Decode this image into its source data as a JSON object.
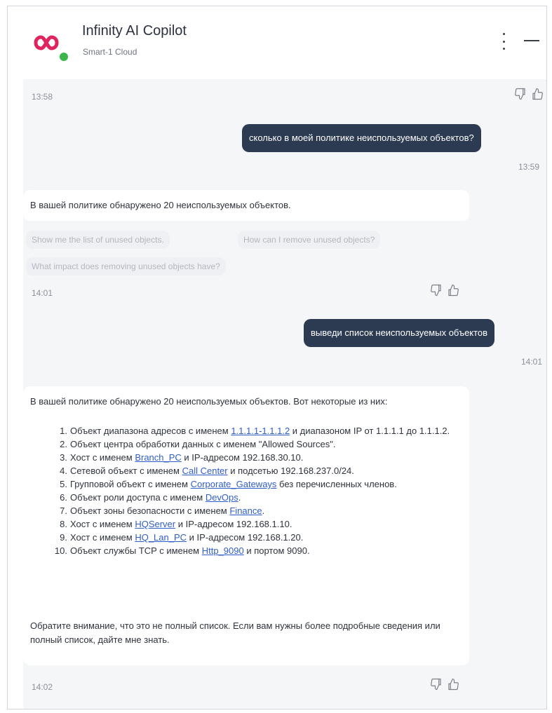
{
  "header": {
    "title": "Infinity AI Copilot",
    "subtitle": "Smart-1 Cloud"
  },
  "colors": {
    "logo": "#e0245e",
    "status": "#3cb54a",
    "user_bubble": "#2c3a52",
    "link": "#2f5ec7"
  },
  "messages": {
    "m0_time": "13:58",
    "m1_text": "сколько в моей политике неиспользуемых объектов?",
    "m1_time": "13:59",
    "m2_text": "В вашей политике обнаружено 20 неиспользуемых объектов.",
    "m2_suggestions": [
      "Show me the list of unused objects.",
      "How can I remove unused objects?",
      "What impact does removing unused objects have?"
    ],
    "m2_time": "14:01",
    "m3_text": "выведи список неиспользуемых объектов",
    "m3_time": "14:01",
    "m4_intro": "В вашей политике обнаружено 20 неиспользуемых объектов. Вот некоторые из них:",
    "m4_items": [
      {
        "num": "1.",
        "pre": "Объект диапазона адресов с именем ",
        "link": "1.1.1.1-1.1.1.2",
        "post": " и диапазоном IP от 1.1.1.1 до 1.1.1.2."
      },
      {
        "num": "2.",
        "pre": "Объект центра обработки данных с именем \"Allowed Sources\".",
        "link": "",
        "post": ""
      },
      {
        "num": "3.",
        "pre": "Хост с именем ",
        "link": "Branch_PC",
        "post": " и IP-адресом 192.168.30.10."
      },
      {
        "num": "4.",
        "pre": "Сетевой объект с именем ",
        "link": "Call Center",
        "post": " и подсетью 192.168.237.0/24."
      },
      {
        "num": "5.",
        "pre": "Групповой объект с именем ",
        "link": "Corporate_Gateways",
        "post": " без перечисленных членов."
      },
      {
        "num": "6.",
        "pre": "Объект роли доступа с именем ",
        "link": "DevOps",
        "post": "."
      },
      {
        "num": "7.",
        "pre": "Объект зоны безопасности с именем ",
        "link": "Finance",
        "post": "."
      },
      {
        "num": "8.",
        "pre": "Хост с именем ",
        "link": "HQServer",
        "post": " и IP-адресом 192.168.1.10."
      },
      {
        "num": "9.",
        "pre": "Хост с именем ",
        "link": "HQ_Lan_PC",
        "post": " и IP-адресом 192.168.1.20."
      },
      {
        "num": "10.",
        "pre": "Объект службы TCP с именем ",
        "link": "Http_9090",
        "post": " и портом 9090."
      }
    ],
    "m4_outro": "Обратите внимание, что это не полный список. Если вам нужны более подробные сведения или полный список, дайте мне знать.",
    "m4_time": "14:02"
  },
  "icons": {
    "logo": "infinity-logo-icon",
    "menu": "kebab-menu-icon",
    "minimize": "minimize-icon",
    "dislike": "thumbs-down-icon",
    "like": "thumbs-up-icon"
  }
}
